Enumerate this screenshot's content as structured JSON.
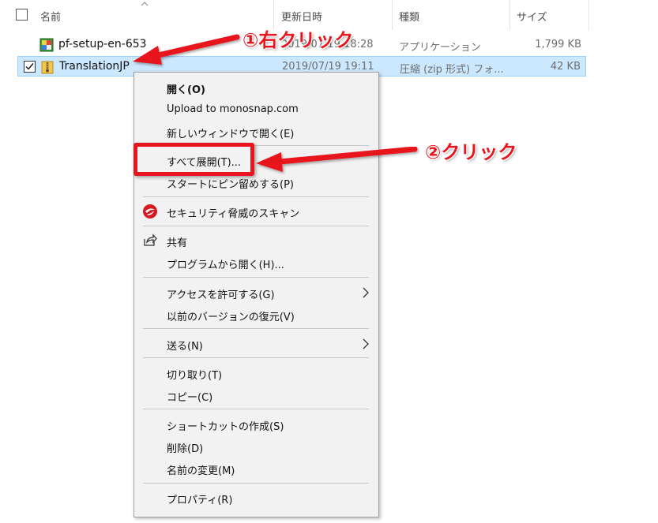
{
  "columns": {
    "name": "名前",
    "date": "更新日時",
    "type": "種類",
    "size": "サイズ"
  },
  "files": [
    {
      "name": "pf-setup-en-653",
      "date": "2019/07/19 18:28",
      "type": "アプリケーション",
      "size": "1,799 KB",
      "icon": "installer-app-icon",
      "selected": false
    },
    {
      "name": "TranslationJP",
      "date": "2019/07/19 19:11",
      "type": "圧縮 (zip 形式) フォ...",
      "size": "42 KB",
      "icon": "zip-folder-icon",
      "selected": true
    }
  ],
  "context_menu": {
    "items": {
      "open": "開く(O)",
      "upload": "Upload to monosnap.com",
      "new_window": "新しいウィンドウで開く(E)",
      "extract_all": "すべて展開(T)...",
      "pin_start": "スタートにピン留めする(P)",
      "security_scan": "セキュリティ脅威のスキャン",
      "share": "共有",
      "open_with": "プログラムから開く(H)...",
      "give_access": "アクセスを許可する(G)",
      "restore_versions": "以前のバージョンの復元(V)",
      "send_to": "送る(N)",
      "cut": "切り取り(T)",
      "copy": "コピー(C)",
      "create_shortcut": "ショートカットの作成(S)",
      "delete": "削除(D)",
      "rename": "名前の変更(M)",
      "properties": "プロパティ(R)"
    }
  },
  "annotations": {
    "step1": "①右クリック",
    "step2": "②クリック"
  },
  "colors": {
    "selection_bg": "#cce8ff",
    "selection_border": "#99d1ff",
    "annotation_red": "#e8141e",
    "menu_bg": "#f2f2f2"
  }
}
